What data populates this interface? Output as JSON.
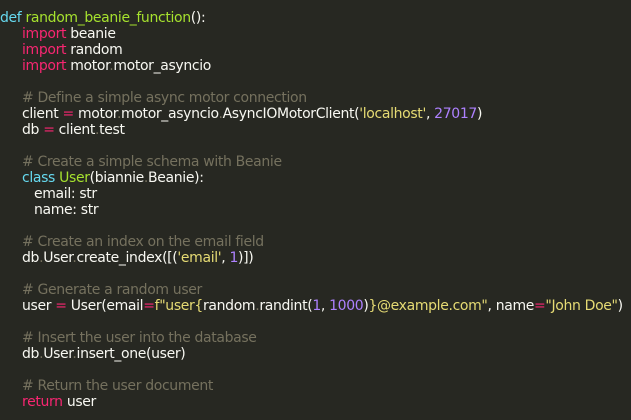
{
  "editor": {
    "theme_colors": {
      "background": "#272822",
      "foreground": "#f8f8f2",
      "keyword": "#f92672",
      "function": "#a6e22e",
      "string": "#e6db74",
      "number": "#ae81ff",
      "comment": "#75715e"
    },
    "lines": [
      {
        "indent": 0,
        "tokens": [
          {
            "t": "def",
            "k": "def"
          },
          {
            "t": " ",
            "k": "plain"
          },
          {
            "t": "random_beanie_function",
            "k": "fn"
          },
          {
            "t": "():",
            "k": "plain"
          }
        ]
      },
      {
        "indent": 1,
        "tokens": [
          {
            "t": "import",
            "k": "kw"
          },
          {
            "t": " beanie",
            "k": "plain"
          }
        ]
      },
      {
        "indent": 1,
        "tokens": [
          {
            "t": "import",
            "k": "kw"
          },
          {
            "t": " random",
            "k": "plain"
          }
        ]
      },
      {
        "indent": 1,
        "tokens": [
          {
            "t": "import",
            "k": "kw"
          },
          {
            "t": " motor",
            "k": "plain"
          },
          {
            "t": ".",
            "k": "dot"
          },
          {
            "t": "motor_asyncio",
            "k": "plain"
          }
        ]
      },
      {
        "indent": 1,
        "tokens": []
      },
      {
        "indent": 1,
        "tokens": [
          {
            "t": "# Define a simple async motor connection",
            "k": "cmt"
          }
        ]
      },
      {
        "indent": 1,
        "tokens": [
          {
            "t": "client ",
            "k": "plain"
          },
          {
            "t": "=",
            "k": "op"
          },
          {
            "t": " motor",
            "k": "plain"
          },
          {
            "t": ".",
            "k": "dot"
          },
          {
            "t": "motor_asyncio",
            "k": "plain"
          },
          {
            "t": ".",
            "k": "dot"
          },
          {
            "t": "AsyncIOMotorClient(",
            "k": "plain"
          },
          {
            "t": "'localhost'",
            "k": "str"
          },
          {
            "t": ", ",
            "k": "plain"
          },
          {
            "t": "27017",
            "k": "num"
          },
          {
            "t": ")",
            "k": "plain"
          }
        ]
      },
      {
        "indent": 1,
        "tokens": [
          {
            "t": "db ",
            "k": "plain"
          },
          {
            "t": "=",
            "k": "op"
          },
          {
            "t": " client",
            "k": "plain"
          },
          {
            "t": ".",
            "k": "dot"
          },
          {
            "t": "test",
            "k": "plain"
          }
        ]
      },
      {
        "indent": 1,
        "tokens": []
      },
      {
        "indent": 1,
        "tokens": [
          {
            "t": "# Create a simple schema with Beanie",
            "k": "cmt"
          }
        ]
      },
      {
        "indent": 1,
        "tokens": [
          {
            "t": "class",
            "k": "def"
          },
          {
            "t": " ",
            "k": "plain"
          },
          {
            "t": "User",
            "k": "cls"
          },
          {
            "t": "(biannie",
            "k": "plain"
          },
          {
            "t": ".",
            "k": "dot"
          },
          {
            "t": "Beanie):",
            "k": "plain"
          }
        ]
      },
      {
        "indent": 2,
        "tokens": [
          {
            "t": "email: str",
            "k": "plain"
          }
        ]
      },
      {
        "indent": 2,
        "tokens": [
          {
            "t": "name: str",
            "k": "plain"
          }
        ]
      },
      {
        "indent": 1,
        "tokens": []
      },
      {
        "indent": 1,
        "tokens": [
          {
            "t": "# Create an index on the email field",
            "k": "cmt"
          }
        ]
      },
      {
        "indent": 1,
        "tokens": [
          {
            "t": "db",
            "k": "plain"
          },
          {
            "t": ".",
            "k": "dot"
          },
          {
            "t": "User",
            "k": "plain"
          },
          {
            "t": ".",
            "k": "dot"
          },
          {
            "t": "create_index([(",
            "k": "plain"
          },
          {
            "t": "'email'",
            "k": "str"
          },
          {
            "t": ", ",
            "k": "plain"
          },
          {
            "t": "1",
            "k": "num"
          },
          {
            "t": ")])",
            "k": "plain"
          }
        ]
      },
      {
        "indent": 1,
        "tokens": []
      },
      {
        "indent": 1,
        "tokens": [
          {
            "t": "# Generate a random user",
            "k": "cmt"
          }
        ]
      },
      {
        "indent": 1,
        "tokens": [
          {
            "t": "user ",
            "k": "plain"
          },
          {
            "t": "=",
            "k": "op"
          },
          {
            "t": " User(email",
            "k": "plain"
          },
          {
            "t": "=",
            "k": "op"
          },
          {
            "t": "f\"user{",
            "k": "str"
          },
          {
            "t": "random",
            "k": "plain"
          },
          {
            "t": ".",
            "k": "dot"
          },
          {
            "t": "randint(",
            "k": "plain"
          },
          {
            "t": "1",
            "k": "num"
          },
          {
            "t": ", ",
            "k": "plain"
          },
          {
            "t": "1000",
            "k": "num"
          },
          {
            "t": ")",
            "k": "plain"
          },
          {
            "t": "}@example.com\"",
            "k": "str"
          },
          {
            "t": ", name",
            "k": "plain"
          },
          {
            "t": "=",
            "k": "op"
          },
          {
            "t": "\"John Doe\"",
            "k": "str"
          },
          {
            "t": ")",
            "k": "plain"
          }
        ]
      },
      {
        "indent": 1,
        "tokens": []
      },
      {
        "indent": 1,
        "tokens": [
          {
            "t": "# Insert the user into the database",
            "k": "cmt"
          }
        ]
      },
      {
        "indent": 1,
        "tokens": [
          {
            "t": "db",
            "k": "plain"
          },
          {
            "t": ".",
            "k": "dot"
          },
          {
            "t": "User",
            "k": "plain"
          },
          {
            "t": ".",
            "k": "dot"
          },
          {
            "t": "insert_one(user)",
            "k": "plain"
          }
        ]
      },
      {
        "indent": 1,
        "tokens": []
      },
      {
        "indent": 1,
        "tokens": [
          {
            "t": "# Return the user document",
            "k": "cmt"
          }
        ]
      },
      {
        "indent": 1,
        "tokens": [
          {
            "t": "return",
            "k": "kw"
          },
          {
            "t": " user",
            "k": "plain"
          }
        ]
      }
    ]
  }
}
